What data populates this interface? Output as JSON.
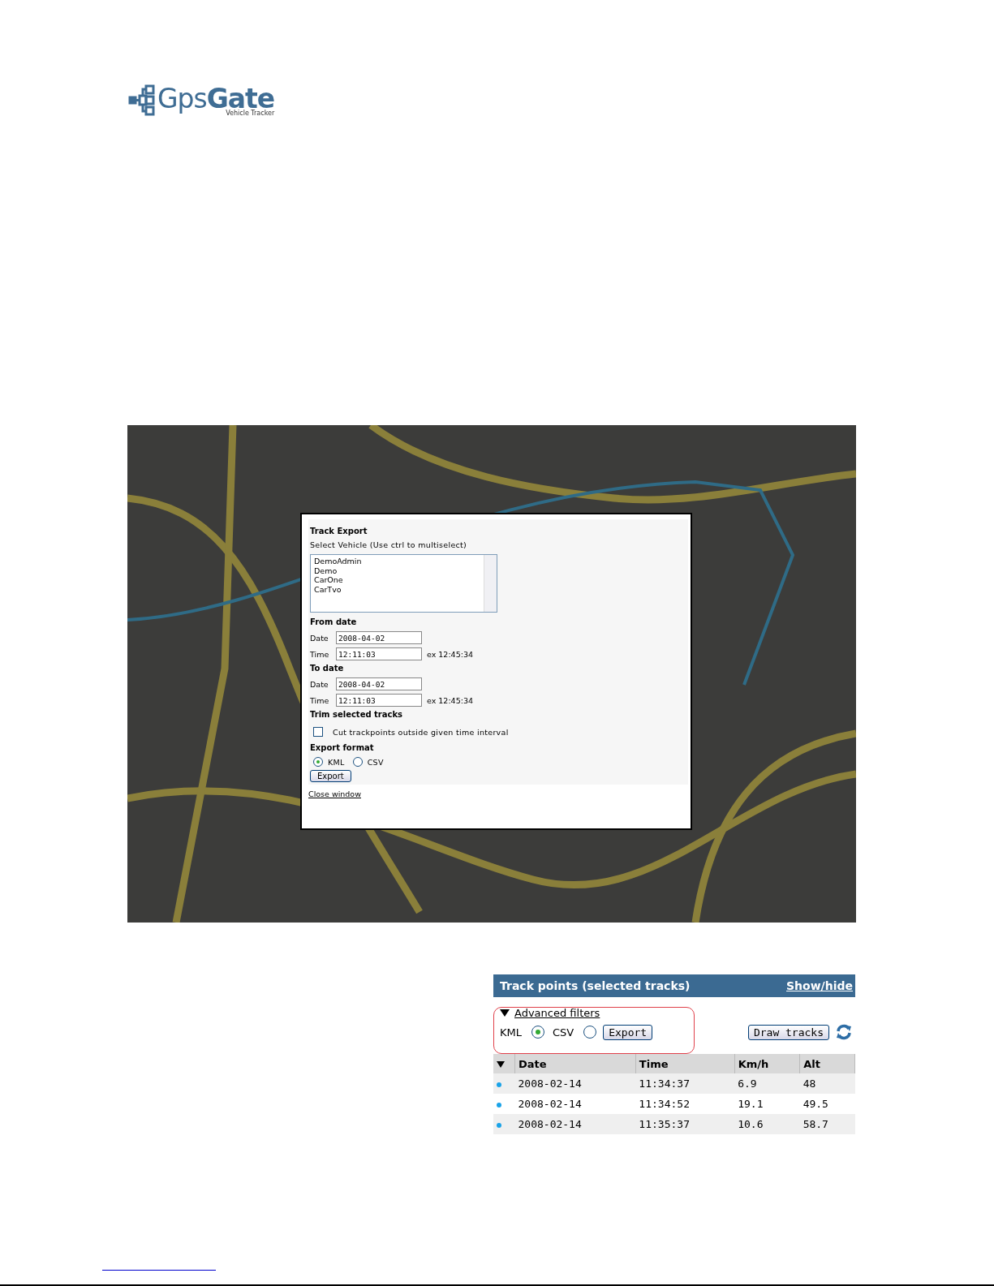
{
  "logo": {
    "name_bold_part": "Gate",
    "name_plain_part": "Gps",
    "tagline": "Vehicle Tracker"
  },
  "track_export_dialog": {
    "title": "Track Export",
    "vehicle_label": "Select Vehicle (Use ctrl to multiselect)",
    "vehicles": [
      {
        "name": "DemoAdmin",
        "selected": false
      },
      {
        "name": "Demo",
        "selected": false
      },
      {
        "name": "CarOne",
        "selected": false
      },
      {
        "name": "CarTvo",
        "selected": false
      }
    ],
    "sections": [
      {
        "heading": "From date",
        "date_label": "Date",
        "date": "2008-04-02",
        "time_label": "Time",
        "time": "12:11:03",
        "hint": "ex 12:45:34"
      },
      {
        "heading": "To date",
        "date_label": "Date",
        "date": "2008-04-02",
        "time_label": "Time",
        "time": "12:11:03",
        "hint": "ex 12:45:34"
      }
    ],
    "trim_heading": "Trim selected tracks",
    "trim_option": {
      "label": "Cut trackpoints outside given time interval",
      "checked": false
    },
    "format_heading": "Export format",
    "formats": [
      {
        "label": "KML",
        "selected": true
      },
      {
        "label": "CSV",
        "selected": false
      }
    ],
    "export_button": "Export",
    "close_link": "Close window"
  },
  "track_points_panel": {
    "title": "Track points (selected tracks)",
    "show_hide_link": "Show/hide",
    "filters_link": "Advanced filters",
    "formats": [
      {
        "label": "KML",
        "selected": true
      },
      {
        "label": "CSV",
        "selected": false
      }
    ],
    "export_button": "Export",
    "draw_button": "Draw tracks",
    "columns": [
      "Date",
      "Time",
      "Km/h",
      "Alt"
    ],
    "rows": [
      [
        "2008-02-14",
        "11:34:37",
        "6.9",
        "48"
      ],
      [
        "2008-02-14",
        "11:34:52",
        "19.1",
        "49.5"
      ],
      [
        "2008-02-14",
        "11:35:37",
        "10.6",
        "58.7"
      ]
    ]
  }
}
